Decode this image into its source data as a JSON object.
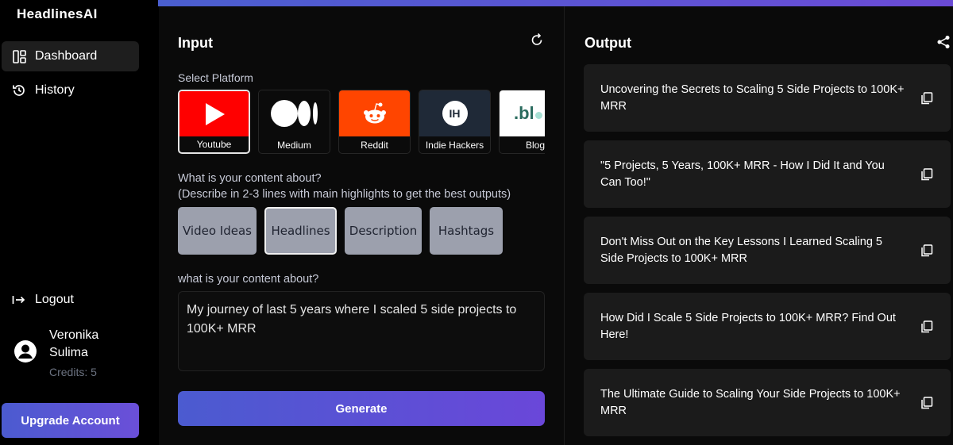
{
  "app": {
    "brand": "HeadlinesAI"
  },
  "sidebar": {
    "items": [
      {
        "label": "Dashboard",
        "icon": "dashboard-icon",
        "active": true
      },
      {
        "label": "History",
        "icon": "history-icon",
        "active": false
      }
    ],
    "logout": {
      "label": "Logout",
      "icon": "logout-icon"
    },
    "user": {
      "name": "Veronika Sulima",
      "credits": "Credits: 5"
    },
    "upgrade_label": "Upgrade Account"
  },
  "input": {
    "title": "Input",
    "platform_label": "Select Platform",
    "platforms": [
      {
        "label": "Youtube",
        "selected": true
      },
      {
        "label": "Medium",
        "selected": false
      },
      {
        "label": "Reddit",
        "selected": false
      },
      {
        "label": "Indie Hackers",
        "logo_text": "IH",
        "selected": false
      },
      {
        "label": "Blog",
        "logo_text": ".bl",
        "selected": false
      }
    ],
    "content_prompt_line1": "What is your content about?",
    "content_prompt_line2": "(Describe in 2-3 lines with main highlights to get the best outputs)",
    "types": [
      {
        "label": "Video Ideas",
        "selected": false
      },
      {
        "label": "Headlines",
        "selected": true
      },
      {
        "label": "Description",
        "selected": false
      },
      {
        "label": "Hashtags",
        "selected": false
      }
    ],
    "content_label": "what is your content about?",
    "content_value": "My journey of last 5 years where I scaled 5 side projects to 100K+ MRR",
    "generate_label": "Generate"
  },
  "output": {
    "title": "Output",
    "results": [
      "Uncovering the Secrets to Scaling 5 Side Projects to 100K+ MRR",
      "\"5 Projects, 5 Years, 100K+ MRR - How I Did It and You Can Too!\"",
      "Don't Miss Out on the Key Lessons I Learned Scaling 5 Side Projects to 100K+ MRR",
      "How Did I Scale 5 Side Projects to 100K+ MRR? Find Out Here!",
      "The Ultimate Guide to Scaling Your Side Projects to 100K+ MRR"
    ]
  },
  "colors": {
    "accent_start": "#4b5bd0",
    "accent_end": "#6a47d9",
    "youtube_red": "#ff0000",
    "reddit_orange": "#ff4500"
  }
}
